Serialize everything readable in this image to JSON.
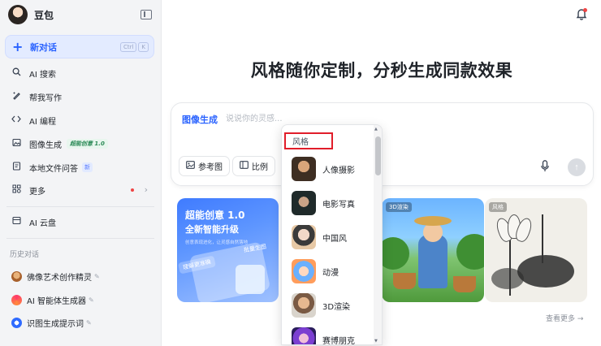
{
  "sidebar": {
    "brand_name": "豆包",
    "new_chat": {
      "label": "新对话",
      "shortcut": [
        "Ctrl",
        "K"
      ]
    },
    "nav": [
      {
        "label": "AI 搜索",
        "icon": "search-icon"
      },
      {
        "label": "帮我写作",
        "icon": "pen-icon"
      },
      {
        "label": "AI 编程",
        "icon": "code-icon"
      },
      {
        "label": "图像生成",
        "icon": "image-icon",
        "badge": "超能创意 1.0"
      },
      {
        "label": "本地文件问答",
        "icon": "file-icon",
        "badge": "新"
      },
      {
        "label": "更多",
        "icon": "grid-icon"
      },
      {
        "label": "AI 云盘",
        "icon": "cloud-drive-icon"
      }
    ],
    "history_title": "历史对话",
    "history": [
      {
        "label": "佛像艺术创作精灵"
      },
      {
        "label": "AI 智能体生成器"
      },
      {
        "label": "识图生成提示词"
      }
    ]
  },
  "main": {
    "headline": "风格随你定制，分秒生成同款效果",
    "input": {
      "mode_label": "图像生成",
      "placeholder": "说说你的灵感..."
    },
    "tools": {
      "reference": "参考图",
      "ratio": "比例"
    },
    "cards": {
      "card1": {
        "title": "超能创意 1.0",
        "subtitle": "全新智能升级",
        "small": "创意表现进化，让灵感自然落地",
        "chip": "理解更准确",
        "chip2": "批量生图"
      },
      "card2": {
        "tag": "3D渲染"
      },
      "card3": {
        "tag": "风格"
      }
    },
    "view_more": "查看更多 →"
  },
  "dropdown": {
    "header": "风格",
    "items": [
      {
        "label": "人像摄影"
      },
      {
        "label": "电影写真"
      },
      {
        "label": "中国风"
      },
      {
        "label": "动漫"
      },
      {
        "label": "3D渲染"
      },
      {
        "label": "赛博朋克"
      }
    ]
  },
  "colors": {
    "accent": "#2962ff",
    "highlight": "#e11d2a"
  }
}
